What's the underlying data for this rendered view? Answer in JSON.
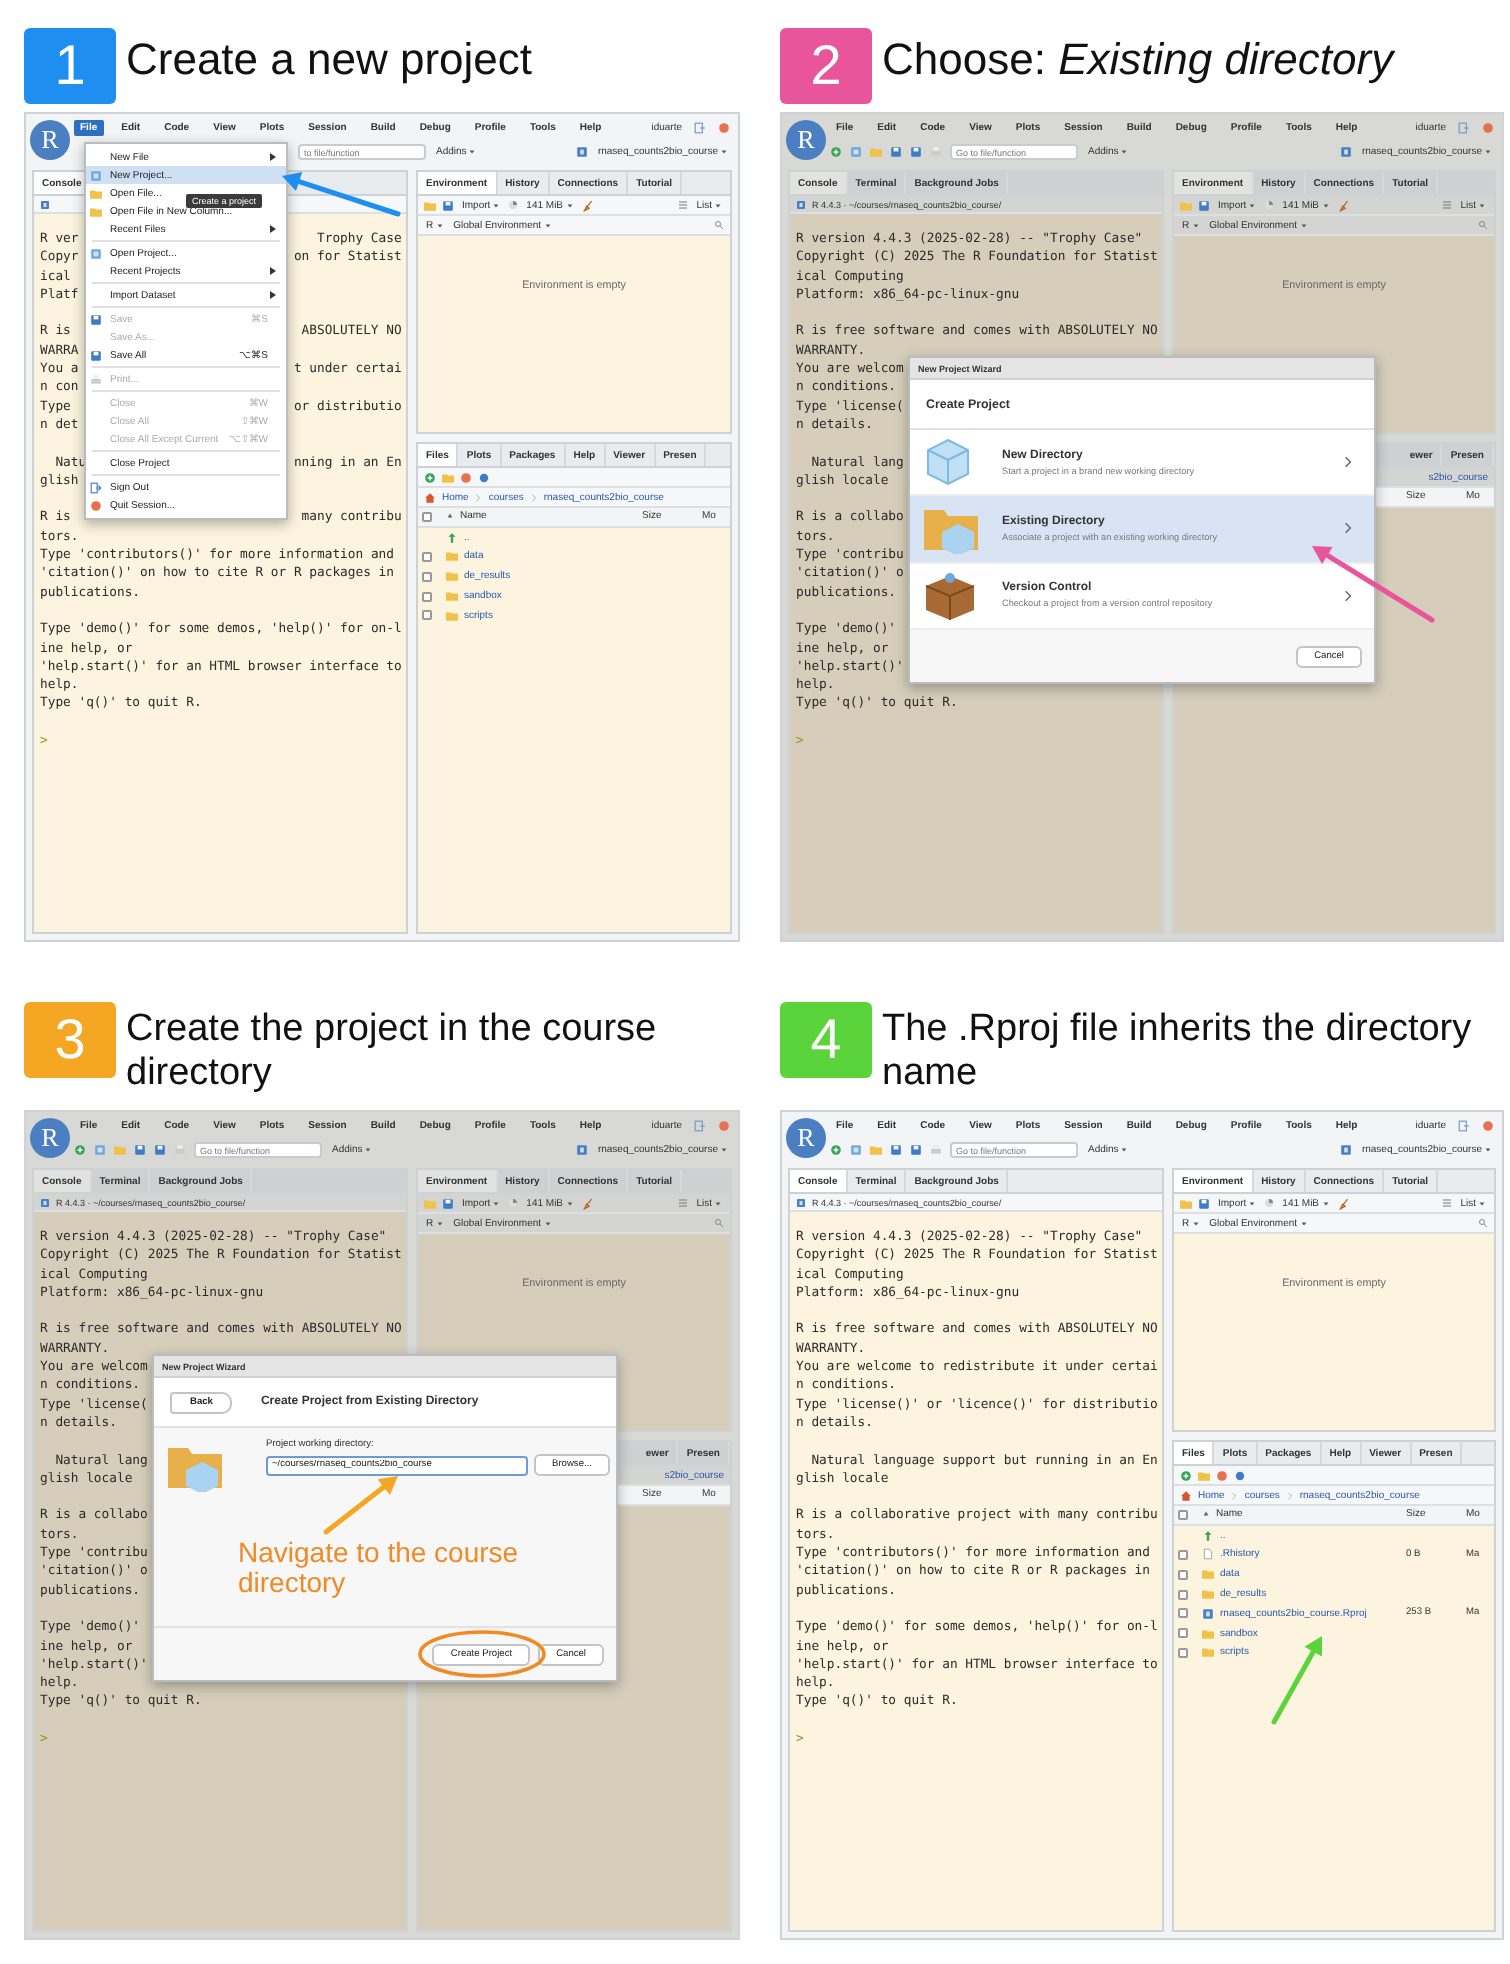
{
  "panels": [
    {
      "step": "1",
      "color": "#1e8ff0",
      "title": "Create a new project",
      "app": {
        "logo": "R",
        "user": "iduarte",
        "menus": [
          {
            "label": "File",
            "selected": true
          },
          {
            "label": "Edit",
            "selected": false
          },
          {
            "label": "Code",
            "selected": false
          },
          {
            "label": "View",
            "selected": false
          },
          {
            "label": "Plots",
            "selected": false
          },
          {
            "label": "Session",
            "selected": false
          },
          {
            "label": "Build",
            "selected": false
          },
          {
            "label": "Debug",
            "selected": false
          },
          {
            "label": "Profile",
            "selected": false
          },
          {
            "label": "Tools",
            "selected": false
          },
          {
            "label": "Help",
            "selected": false
          }
        ],
        "toolbar": {
          "search": "to file/function",
          "addins": "Addins",
          "project": "rnaseq_counts2bio_course"
        },
        "console": {
          "tabs": [
            {
              "label": "Console",
              "selected": true
            }
          ],
          "prompt": ">",
          "lines": [
            {
              "kind": "text",
              "text": "R ver",
              "tail": "Trophy Case"
            },
            {
              "kind": "text",
              "text": "Copyr",
              "tail": "on for Statist"
            },
            {
              "kind": "text",
              "text": "ical"
            },
            {
              "kind": "text",
              "text": "Platf"
            },
            {
              "kind": "blank"
            },
            {
              "kind": "text",
              "text": "R is",
              "tail": "ABSOLUTELY NO"
            },
            {
              "kind": "text",
              "text": "WARRA"
            },
            {
              "kind": "text",
              "text": "You a",
              "tail": "t under certai"
            },
            {
              "kind": "text",
              "text": "n con"
            },
            {
              "kind": "text",
              "text": "Type",
              "tail": "or distributio"
            },
            {
              "kind": "text",
              "text": "n det"
            },
            {
              "kind": "blank"
            },
            {
              "kind": "text",
              "text": "  Natu",
              "tail": "nning in an En"
            },
            {
              "kind": "text",
              "text": "glish"
            },
            {
              "kind": "blank"
            },
            {
              "kind": "text",
              "text": "R is",
              "tail": "many contribu"
            },
            {
              "kind": "text",
              "text": "tors."
            },
            {
              "kind": "text",
              "text": "Type 'contributors()' for more information and"
            },
            {
              "kind": "text",
              "text": "'citation()' on how to cite R or R packages in"
            },
            {
              "kind": "text",
              "text": "publications."
            },
            {
              "kind": "blank"
            },
            {
              "kind": "text",
              "text": "Type 'demo()' for some demos, 'help()' for on-l"
            },
            {
              "kind": "text",
              "text": "ine help, or"
            },
            {
              "kind": "text",
              "text": "'help.start()' for an HTML browser interface to"
            },
            {
              "kind": "text",
              "text": "help."
            },
            {
              "kind": "text",
              "text": "Type 'q()' to quit R."
            },
            {
              "kind": "blank"
            }
          ]
        },
        "environment": {
          "tabs": [
            {
              "label": "Environment",
              "selected": true
            },
            {
              "label": "History",
              "selected": false
            },
            {
              "label": "Connections",
              "selected": false
            },
            {
              "label": "Tutorial",
              "selected": false
            }
          ],
          "import": "Import",
          "memory": "141 MiB",
          "view": "List",
          "language": "R",
          "scope": "Global Environment",
          "message": "Environment is empty"
        },
        "files": {
          "header_checked": false,
          "tabs": [
            {
              "label": "Files",
              "selected": true
            },
            {
              "label": "Plots",
              "selected": false
            },
            {
              "label": "Packages",
              "selected": false
            },
            {
              "label": "Help",
              "selected": false
            },
            {
              "label": "Viewer",
              "selected": false
            },
            {
              "label": "Presen",
              "selected": false
            }
          ],
          "crumbs": [
            "Home",
            "courses",
            "rnaseq_counts2bio_course"
          ],
          "columns": [
            {
              "kind": "name",
              "label": "Name"
            },
            {
              "kind": "size",
              "label": "Size"
            },
            {
              "kind": "modified",
              "label": "Mo"
            }
          ],
          "rows": [
            {
              "kind": "up",
              "name": ".."
            },
            {
              "kind": "folder",
              "name": "data",
              "checked": false
            },
            {
              "kind": "folder",
              "name": "de_results",
              "checked": false
            },
            {
              "kind": "folder",
              "name": "sandbox",
              "checked": false
            },
            {
              "kind": "folder",
              "name": "scripts",
              "checked": false
            }
          ]
        },
        "menu": {
          "tooltip": "Create a project",
          "items": [
            {
              "kind": "plain",
              "label": "New File",
              "submenu": true,
              "disabled": false,
              "selected": false
            },
            {
              "kind": "project",
              "label": "New Project...",
              "submenu": false,
              "disabled": false,
              "selected": true
            },
            {
              "kind": "folder",
              "label": "Open File...",
              "submenu": false,
              "disabled": false,
              "selected": false
            },
            {
              "kind": "folder",
              "label": "Open File in New Column...",
              "submenu": false,
              "disabled": false,
              "selected": false
            },
            {
              "kind": "plain",
              "label": "Recent Files",
              "submenu": true,
              "disabled": false,
              "selected": false
            },
            {
              "kind": "separator"
            },
            {
              "kind": "project",
              "label": "Open Project...",
              "submenu": false,
              "disabled": false,
              "selected": false
            },
            {
              "kind": "plain",
              "label": "Recent Projects",
              "submenu": true,
              "disabled": false,
              "selected": false
            },
            {
              "kind": "separator"
            },
            {
              "kind": "plain",
              "label": "Import Dataset",
              "submenu": true,
              "disabled": false,
              "selected": false
            },
            {
              "kind": "separator"
            },
            {
              "kind": "disk",
              "label": "Save",
              "shortcut": "⌘S",
              "submenu": false,
              "disabled": true,
              "selected": false
            },
            {
              "kind": "plain",
              "label": "Save As...",
              "submenu": false,
              "disabled": true,
              "selected": false
            },
            {
              "kind": "disk",
              "label": "Save All",
              "shortcut": "⌥⌘S",
              "submenu": false,
              "disabled": false,
              "selected": false
            },
            {
              "kind": "separator"
            },
            {
              "kind": "printer",
              "label": "Print...",
              "submenu": false,
              "disabled": true,
              "selected": false
            },
            {
              "kind": "separator"
            },
            {
              "kind": "plain",
              "label": "Close",
              "shortcut": "⌘W",
              "submenu": false,
              "disabled": true,
              "selected": false
            },
            {
              "kind": "plain",
              "label": "Close All",
              "shortcut": "⇧⌘W",
              "submenu": false,
              "disabled": true,
              "selected": false
            },
            {
              "kind": "plain",
              "label": "Close All Except Current",
              "shortcut": "⌥⇧⌘W",
              "submenu": false,
              "disabled": true,
              "selected": false
            },
            {
              "kind": "separator"
            },
            {
              "kind": "plain",
              "label": "Close Project",
              "submenu": false,
              "disabled": false,
              "selected": false
            },
            {
              "kind": "separator"
            },
            {
              "kind": "signout",
              "label": "Sign Out",
              "submenu": false,
              "disabled": false,
              "selected": false
            },
            {
              "kind": "quit",
              "label": "Quit Session...",
              "submenu": false,
              "disabled": false,
              "selected": false
            }
          ]
        }
      }
    },
    {
      "step": "2",
      "color": "#e8559b",
      "title": "Choose: *Existing directory*",
      "app": {
        "logo": "R",
        "user": "iduarte",
        "menus": [
          {
            "label": "File",
            "selected": false
          },
          {
            "label": "Edit",
            "selected": false
          },
          {
            "label": "Code",
            "selected": false
          },
          {
            "label": "View",
            "selected": false
          },
          {
            "label": "Plots",
            "selected": false
          },
          {
            "label": "Session",
            "selected": false
          },
          {
            "label": "Build",
            "selected": false
          },
          {
            "label": "Debug",
            "selected": false
          },
          {
            "label": "Profile",
            "selected": false
          },
          {
            "label": "Tools",
            "selected": false
          },
          {
            "label": "Help",
            "selected": false
          }
        ],
        "toolbar": {
          "search": "Go to file/function",
          "addins": "Addins",
          "project": "rnaseq_counts2bio_course"
        },
        "console": {
          "tabs": [
            {
              "label": "Console",
              "selected": true
            },
            {
              "label": "Terminal",
              "selected": false
            },
            {
              "label": "Background Jobs",
              "selected": false
            }
          ],
          "path": "R 4.4.3 · ~/courses/rnaseq_counts2bio_course/",
          "prompt": ">",
          "lines": [
            {
              "kind": "text",
              "text": "R version 4.4.3 (2025-02-28) -- \"Trophy Case\""
            },
            {
              "kind": "text",
              "text": "Copyright (C) 2025 The R Foundation for Statist"
            },
            {
              "kind": "text",
              "text": "ical Computing"
            },
            {
              "kind": "text",
              "text": "Platform: x86_64-pc-linux-gnu"
            },
            {
              "kind": "blank"
            },
            {
              "kind": "text",
              "text": "R is free software and comes with ABSOLUTELY NO"
            },
            {
              "kind": "text",
              "text": "WARRANTY."
            },
            {
              "kind": "text",
              "text": "You are welcom"
            },
            {
              "kind": "text",
              "text": "n conditions."
            },
            {
              "kind": "text",
              "text": "Type 'license("
            },
            {
              "kind": "text",
              "text": "n details."
            },
            {
              "kind": "blank"
            },
            {
              "kind": "text",
              "text": "  Natural lang"
            },
            {
              "kind": "text",
              "text": "glish locale"
            },
            {
              "kind": "blank"
            },
            {
              "kind": "text",
              "text": "R is a collabo"
            },
            {
              "kind": "text",
              "text": "tors."
            },
            {
              "kind": "text",
              "text": "Type 'contribu"
            },
            {
              "kind": "text",
              "text": "'citation()' o"
            },
            {
              "kind": "text",
              "text": "publications."
            },
            {
              "kind": "blank"
            },
            {
              "kind": "text",
              "text": "Type 'demo()'"
            },
            {
              "kind": "text",
              "text": "ine help, or"
            },
            {
              "kind": "text",
              "text": "'help.start()'"
            },
            {
              "kind": "text",
              "text": "help."
            },
            {
              "kind": "text",
              "text": "Type 'q()' to quit R."
            },
            {
              "kind": "blank"
            }
          ]
        },
        "environment": {
          "tabs": [
            {
              "label": "Environment",
              "selected": true
            },
            {
              "label": "History",
              "selected": false
            },
            {
              "label": "Connections",
              "selected": false
            },
            {
              "label": "Tutorial",
              "selected": false
            }
          ],
          "import": "Import",
          "memory": "141 MiB",
          "view": "List",
          "language": "R",
          "scope": "Global Environment",
          "message": "Environment is empty"
        },
        "files": {
          "tabs": [
            {
              "label": "ewer",
              "selected": false
            },
            {
              "label": "Presen",
              "selected": false
            }
          ],
          "crumbs": [
            "s2bio_course"
          ],
          "columns": [
            {
              "kind": "size",
              "label": "Size"
            },
            {
              "kind": "modified",
              "label": "Mo"
            }
          ]
        },
        "dialog": {
          "kind": "choose",
          "title": "New Project Wizard",
          "heading": "Create Project",
          "cancel": "Cancel",
          "options": [
            {
              "kind": "new",
              "name": "New Directory",
              "description": "Start a project in a brand new working directory",
              "selected": false
            },
            {
              "kind": "existing",
              "name": "Existing Directory",
              "description": "Associate a project with an existing working directory",
              "selected": true
            },
            {
              "kind": "vcs",
              "name": "Version Control",
              "description": "Checkout a project from a version control repository",
              "selected": false
            }
          ]
        }
      }
    },
    {
      "step": "3",
      "color": "#f5a623",
      "title": "Create the project in the course directory",
      "app": {
        "logo": "R",
        "user": "iduarte",
        "menus": [
          {
            "label": "File",
            "selected": false
          },
          {
            "label": "Edit",
            "selected": false
          },
          {
            "label": "Code",
            "selected": false
          },
          {
            "label": "View",
            "selected": false
          },
          {
            "label": "Plots",
            "selected": false
          },
          {
            "label": "Session",
            "selected": false
          },
          {
            "label": "Build",
            "selected": false
          },
          {
            "label": "Debug",
            "selected": false
          },
          {
            "label": "Profile",
            "selected": false
          },
          {
            "label": "Tools",
            "selected": false
          },
          {
            "label": "Help",
            "selected": false
          }
        ],
        "toolbar": {
          "search": "Go to file/function",
          "addins": "Addins",
          "project": "rnaseq_counts2bio_course"
        },
        "console": {
          "tabs": [
            {
              "label": "Console",
              "selected": true
            },
            {
              "label": "Terminal",
              "selected": false
            },
            {
              "label": "Background Jobs",
              "selected": false
            }
          ],
          "path": "R 4.4.3 · ~/courses/rnaseq_counts2bio_course/",
          "prompt": ">",
          "lines": [
            {
              "kind": "text",
              "text": "R version 4.4.3 (2025-02-28) -- \"Trophy Case\""
            },
            {
              "kind": "text",
              "text": "Copyright (C) 2025 The R Foundation for Statist"
            },
            {
              "kind": "text",
              "text": "ical Computing"
            },
            {
              "kind": "text",
              "text": "Platform: x86_64-pc-linux-gnu"
            },
            {
              "kind": "blank"
            },
            {
              "kind": "text",
              "text": "R is free software and comes with ABSOLUTELY NO"
            },
            {
              "kind": "text",
              "text": "WARRANTY."
            },
            {
              "kind": "text",
              "text": "You are welcom"
            },
            {
              "kind": "text",
              "text": "n conditions."
            },
            {
              "kind": "text",
              "text": "Type 'license("
            },
            {
              "kind": "text",
              "text": "n details."
            },
            {
              "kind": "blank"
            },
            {
              "kind": "text",
              "text": "  Natural lang"
            },
            {
              "kind": "text",
              "text": "glish locale"
            },
            {
              "kind": "blank"
            },
            {
              "kind": "text",
              "text": "R is a collabo"
            },
            {
              "kind": "text",
              "text": "tors."
            },
            {
              "kind": "text",
              "text": "Type 'contribu"
            },
            {
              "kind": "text",
              "text": "'citation()' o"
            },
            {
              "kind": "text",
              "text": "publications."
            },
            {
              "kind": "blank"
            },
            {
              "kind": "text",
              "text": "Type 'demo()'"
            },
            {
              "kind": "text",
              "text": "ine help, or"
            },
            {
              "kind": "text",
              "text": "'help.start()'"
            },
            {
              "kind": "text",
              "text": "help."
            },
            {
              "kind": "text",
              "text": "Type 'q()' to quit R."
            },
            {
              "kind": "blank"
            }
          ]
        },
        "environment": {
          "tabs": [
            {
              "label": "Environment",
              "selected": true
            },
            {
              "label": "History",
              "selected": false
            },
            {
              "label": "Connections",
              "selected": false
            },
            {
              "label": "Tutorial",
              "selected": false
            }
          ],
          "import": "Import",
          "memory": "141 MiB",
          "view": "List",
          "language": "R",
          "scope": "Global Environment",
          "message": "Environment is empty"
        },
        "files": {
          "tabs": [
            {
              "label": "ewer",
              "selected": false
            },
            {
              "label": "Presen",
              "selected": false
            }
          ],
          "crumbs": [
            "s2bio_course"
          ],
          "columns": [
            {
              "kind": "size",
              "label": "Size"
            },
            {
              "kind": "modified",
              "label": "Mo"
            }
          ]
        },
        "dialog": {
          "kind": "existing",
          "title": "New Project Wizard",
          "back": "Back",
          "heading": "Create Project from Existing Directory",
          "label": "Project working directory:",
          "value": "~/courses/rnaseq_counts2bio_course",
          "browse": "Browse...",
          "note": "Navigate to the course directory",
          "create": "Create Project",
          "cancel": "Cancel",
          "highlight": true
        }
      }
    },
    {
      "step": "4",
      "color": "#5ad43a",
      "title": "The .Rproj file inherits the directory name",
      "app": {
        "logo": "R",
        "user": "iduarte",
        "menus": [
          {
            "label": "File",
            "selected": false
          },
          {
            "label": "Edit",
            "selected": false
          },
          {
            "label": "Code",
            "selected": false
          },
          {
            "label": "View",
            "selected": false
          },
          {
            "label": "Plots",
            "selected": false
          },
          {
            "label": "Session",
            "selected": false
          },
          {
            "label": "Build",
            "selected": false
          },
          {
            "label": "Debug",
            "selected": false
          },
          {
            "label": "Profile",
            "selected": false
          },
          {
            "label": "Tools",
            "selected": false
          },
          {
            "label": "Help",
            "selected": false
          }
        ],
        "toolbar": {
          "search": "Go to file/function",
          "addins": "Addins",
          "project": "rnaseq_counts2bio_course"
        },
        "console": {
          "tabs": [
            {
              "label": "Console",
              "selected": true
            },
            {
              "label": "Terminal",
              "selected": false
            },
            {
              "label": "Background Jobs",
              "selected": false
            }
          ],
          "path": "R 4.4.3 · ~/courses/rnaseq_counts2bio_course/",
          "prompt": ">",
          "lines": [
            {
              "kind": "text",
              "text": "R version 4.4.3 (2025-02-28) -- \"Trophy Case\""
            },
            {
              "kind": "text",
              "text": "Copyright (C) 2025 The R Foundation for Statist"
            },
            {
              "kind": "text",
              "text": "ical Computing"
            },
            {
              "kind": "text",
              "text": "Platform: x86_64-pc-linux-gnu"
            },
            {
              "kind": "blank"
            },
            {
              "kind": "text",
              "text": "R is free software and comes with ABSOLUTELY NO"
            },
            {
              "kind": "text",
              "text": "WARRANTY."
            },
            {
              "kind": "text",
              "text": "You are welcome to redistribute it under certai"
            },
            {
              "kind": "text",
              "text": "n conditions."
            },
            {
              "kind": "text",
              "text": "Type 'license()' or 'licence()' for distributio"
            },
            {
              "kind": "text",
              "text": "n details."
            },
            {
              "kind": "blank"
            },
            {
              "kind": "text",
              "text": "  Natural language support but running in an En"
            },
            {
              "kind": "text",
              "text": "glish locale"
            },
            {
              "kind": "blank"
            },
            {
              "kind": "text",
              "text": "R is a collaborative project with many contribu"
            },
            {
              "kind": "text",
              "text": "tors."
            },
            {
              "kind": "text",
              "text": "Type 'contributors()' for more information and"
            },
            {
              "kind": "text",
              "text": "'citation()' on how to cite R or R packages in"
            },
            {
              "kind": "text",
              "text": "publications."
            },
            {
              "kind": "blank"
            },
            {
              "kind": "text",
              "text": "Type 'demo()' for some demos, 'help()' for on-l"
            },
            {
              "kind": "text",
              "text": "ine help, or"
            },
            {
              "kind": "text",
              "text": "'help.start()' for an HTML browser interface to"
            },
            {
              "kind": "text",
              "text": "help."
            },
            {
              "kind": "text",
              "text": "Type 'q()' to quit R."
            },
            {
              "kind": "blank"
            }
          ]
        },
        "environment": {
          "tabs": [
            {
              "label": "Environment",
              "selected": true
            },
            {
              "label": "History",
              "selected": false
            },
            {
              "label": "Connections",
              "selected": false
            },
            {
              "label": "Tutorial",
              "selected": false
            }
          ],
          "import": "Import",
          "memory": "141 MiB",
          "view": "List",
          "language": "R",
          "scope": "Global Environment",
          "message": "Environment is empty"
        },
        "files": {
          "header_checked": false,
          "tabs": [
            {
              "label": "Files",
              "selected": true
            },
            {
              "label": "Plots",
              "selected": false
            },
            {
              "label": "Packages",
              "selected": false
            },
            {
              "label": "Help",
              "selected": false
            },
            {
              "label": "Viewer",
              "selected": false
            },
            {
              "label": "Presen",
              "selected": false
            }
          ],
          "crumbs": [
            "Home",
            "courses",
            "rnaseq_counts2bio_course"
          ],
          "columns": [
            {
              "kind": "name",
              "label": "Name"
            },
            {
              "kind": "size",
              "label": "Size"
            },
            {
              "kind": "modified",
              "label": "Mo"
            }
          ],
          "rows": [
            {
              "kind": "up",
              "name": ".."
            },
            {
              "kind": "file",
              "name": ".Rhistory",
              "size": "0 B",
              "modified": "Ma",
              "checked": false
            },
            {
              "kind": "folder",
              "name": "data",
              "checked": false
            },
            {
              "kind": "folder",
              "name": "de_results",
              "checked": false
            },
            {
              "kind": "project",
              "name": "rnaseq_counts2bio_course.Rproj",
              "size": "253 B",
              "modified": "Ma",
              "checked": false
            },
            {
              "kind": "folder",
              "name": "sandbox",
              "checked": false
            },
            {
              "kind": "folder",
              "name": "scripts",
              "checked": false
            }
          ]
        }
      }
    }
  ]
}
